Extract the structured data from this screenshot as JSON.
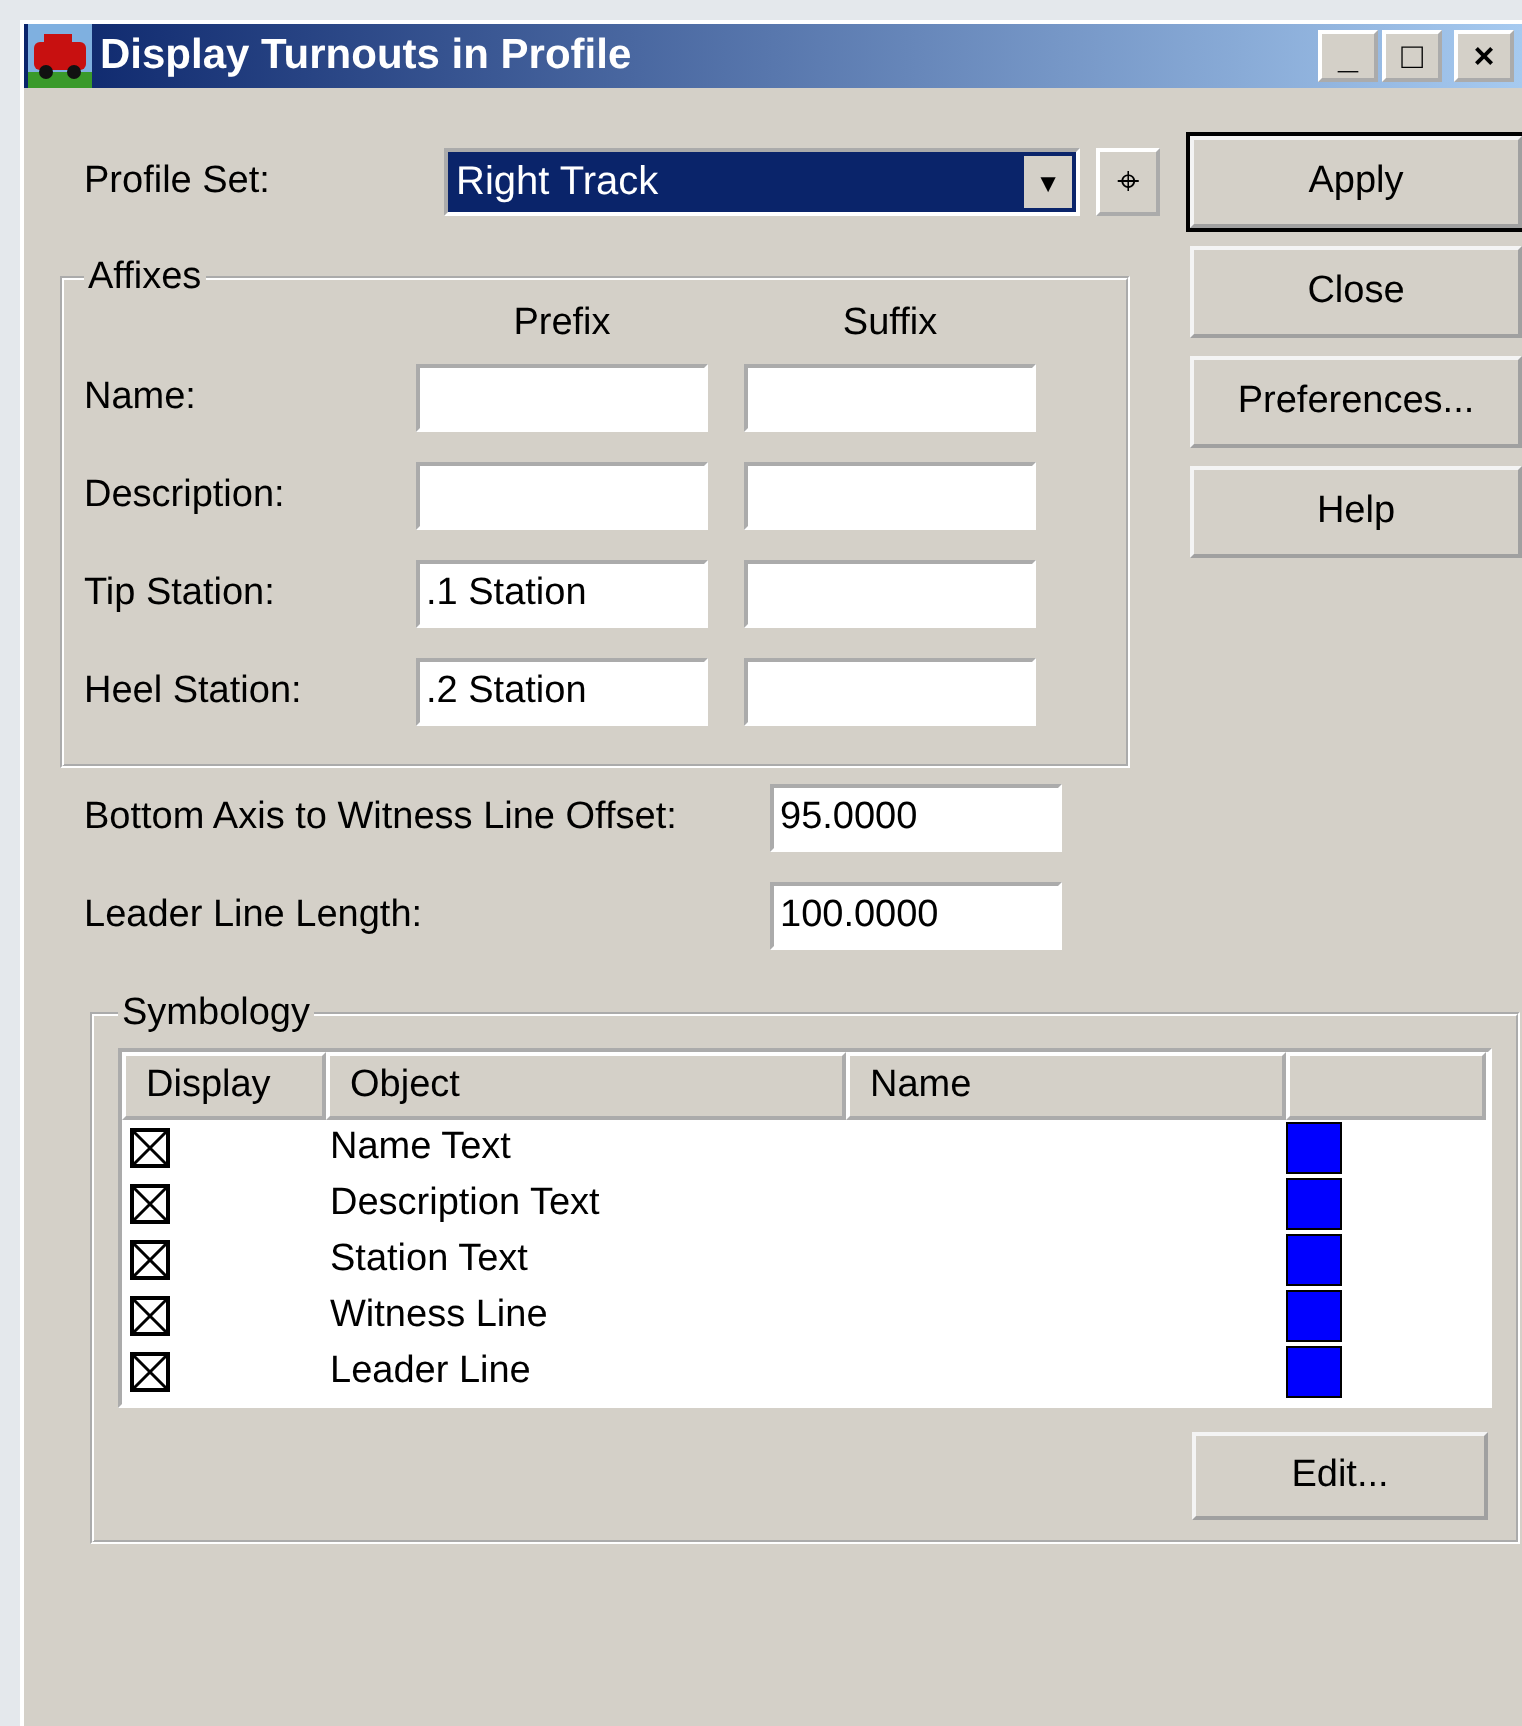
{
  "window": {
    "title": "Display Turnouts in Profile",
    "controls": [
      "_",
      "□",
      "×"
    ]
  },
  "profile_set": {
    "label": "Profile Set:",
    "value": "Right Track",
    "dropdown": "▼",
    "pick": "⌖"
  },
  "buttons": [
    {
      "label": "Apply",
      "default": true
    },
    {
      "label": "Close",
      "default": false
    },
    {
      "label": "Preferences...",
      "default": false
    },
    {
      "label": "Help",
      "default": false
    }
  ],
  "affixes": {
    "title": "Affixes",
    "columns": [
      "Prefix",
      "Suffix"
    ],
    "rows": [
      {
        "label": "Name:",
        "prefix": "",
        "suffix": ""
      },
      {
        "label": "Description:",
        "prefix": "",
        "suffix": ""
      },
      {
        "label": "Tip Station:",
        "prefix": ".1 Station",
        "suffix": ""
      },
      {
        "label": "Heel Station:",
        "prefix": ".2 Station",
        "suffix": ""
      }
    ]
  },
  "offsets": [
    {
      "label": "Bottom Axis to Witness Line Offset:",
      "value": "95.0000"
    },
    {
      "label": "Leader Line Length:",
      "value": "100.0000"
    }
  ],
  "symbology": {
    "title": "Symbology",
    "columns": [
      "Display",
      "Object",
      "Name"
    ],
    "rows": [
      {
        "display": true,
        "object": "Name Text",
        "color": "#0000ff"
      },
      {
        "display": true,
        "object": "Description Text",
        "color": "#0000ff"
      },
      {
        "display": true,
        "object": "Station Text",
        "color": "#0000ff"
      },
      {
        "display": true,
        "object": "Witness Line",
        "color": "#0000ff"
      },
      {
        "display": true,
        "object": "Leader Line",
        "color": "#0000ff"
      }
    ],
    "edit_button": "Edit..."
  }
}
